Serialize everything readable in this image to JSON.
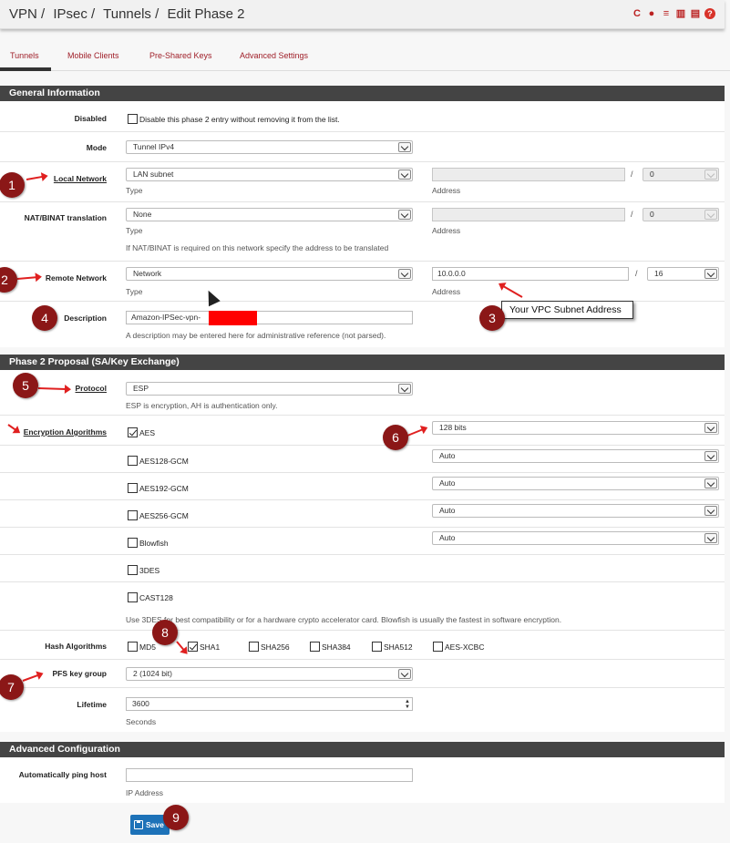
{
  "breadcrumb": [
    "VPN /",
    "IPsec /",
    "Tunnels /",
    "Edit Phase 2"
  ],
  "tabs": [
    "Tunnels",
    "Mobile Clients",
    "Pre-Shared Keys",
    "Advanced Settings"
  ],
  "sections": {
    "general": "General Information",
    "phase2": "Phase 2 Proposal (SA/Key Exchange)",
    "advanced": "Advanced Configuration"
  },
  "disabled": {
    "label": "Disabled",
    "text": "Disable this phase 2 entry without removing it from the list."
  },
  "mode": {
    "label": "Mode",
    "value": "Tunnel IPv4"
  },
  "local_network": {
    "label": "Local Network",
    "type_value": "LAN subnet",
    "type_hint": "Type",
    "address_value": "",
    "address_hint": "Address",
    "mask": "0"
  },
  "nat": {
    "label": "NAT/BINAT translation",
    "type_value": "None",
    "type_hint": "Type",
    "address_hint": "Address",
    "mask": "0",
    "note": "If NAT/BINAT is required on this network specify the address to be translated"
  },
  "remote_network": {
    "label": "Remote Network",
    "type_value": "Network",
    "type_hint": "Type",
    "address_value": "10.0.0.0",
    "address_hint": "Address",
    "mask": "16"
  },
  "description": {
    "label": "Description",
    "value": "Amazon-IPSec-vpn-",
    "note": "A description may be entered here for administrative reference (not parsed)."
  },
  "protocol": {
    "label": "Protocol",
    "value": "ESP",
    "note": "ESP is encryption, AH is authentication only."
  },
  "encryption": {
    "label": "Encryption Algorithms",
    "items": [
      {
        "name": "AES",
        "checked": true,
        "keylen": "128 bits"
      },
      {
        "name": "AES128-GCM",
        "checked": false,
        "keylen": "Auto"
      },
      {
        "name": "AES192-GCM",
        "checked": false,
        "keylen": "Auto"
      },
      {
        "name": "AES256-GCM",
        "checked": false,
        "keylen": "Auto"
      },
      {
        "name": "Blowfish",
        "checked": false,
        "keylen": "Auto"
      },
      {
        "name": "3DES",
        "checked": false,
        "keylen": ""
      },
      {
        "name": "CAST128",
        "checked": false,
        "keylen": ""
      }
    ],
    "note": "Use 3DES for best compatibility or for a hardware crypto accelerator card. Blowfish is usually the fastest in software encryption."
  },
  "hash": {
    "label": "Hash Algorithms",
    "items": [
      {
        "name": "MD5",
        "checked": false
      },
      {
        "name": "SHA1",
        "checked": true
      },
      {
        "name": "SHA256",
        "checked": false
      },
      {
        "name": "SHA384",
        "checked": false
      },
      {
        "name": "SHA512",
        "checked": false
      },
      {
        "name": "AES-XCBC",
        "checked": false
      }
    ]
  },
  "pfs": {
    "label": "PFS key group",
    "value": "2 (1024 bit)"
  },
  "lifetime": {
    "label": "Lifetime",
    "value": "3600",
    "hint": "Seconds"
  },
  "ping": {
    "label": "Automatically ping host",
    "value": "",
    "hint": "IP Address"
  },
  "save_label": "Save",
  "annotations": {
    "tooltip": "Your VPC Subnet Address",
    "badges": [
      "1",
      "2",
      "3",
      "4",
      "5",
      "6",
      "7",
      "8",
      "9"
    ]
  },
  "colors": {
    "accent": "#a0202a",
    "section_header": "#444444",
    "badge": "#8b1717",
    "arrow": "#e02020",
    "save": "#1d72b8"
  }
}
